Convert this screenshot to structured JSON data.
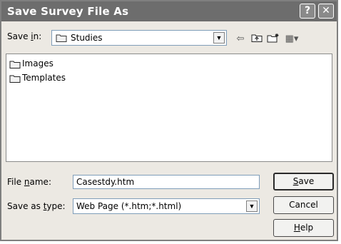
{
  "window": {
    "title": "Save Survey File As",
    "help_glyph": "?",
    "close_glyph": "✕"
  },
  "savein": {
    "label_pre": "Save ",
    "label_accel": "i",
    "label_post": "n:",
    "value": "Studies",
    "icon": "folder-icon"
  },
  "toolbar": {
    "back_glyph": "⇦",
    "up_glyph": "⤴",
    "newfolder_glyph": "✱",
    "views_glyph": "▦▾"
  },
  "list": {
    "items": [
      {
        "label": "Images",
        "icon": "folder-icon"
      },
      {
        "label": "Templates",
        "icon": "folder-icon"
      }
    ]
  },
  "filename": {
    "label_pre": "File ",
    "label_accel": "n",
    "label_post": "ame:",
    "value": "Casestdy.htm"
  },
  "filetype": {
    "label_pre": "Save as ",
    "label_accel": "t",
    "label_post": "ype:",
    "value": "Web Page (*.htm;*.html)"
  },
  "buttons": {
    "save_accel": "S",
    "save_rest": "ave",
    "cancel": "Cancel",
    "help_accel": "H",
    "help_rest": "elp"
  }
}
